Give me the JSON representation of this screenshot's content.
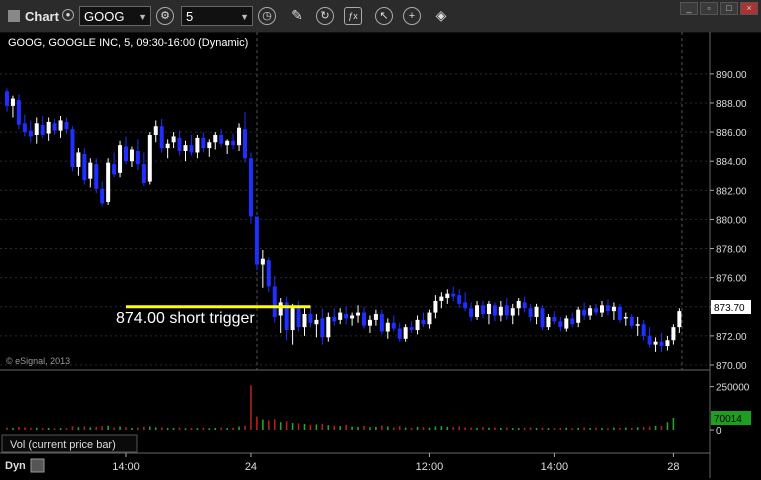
{
  "toolbar": {
    "app_title": "Chart",
    "symbol": "GOOG",
    "interval": "5",
    "icons": [
      "chart-type-icon",
      "interval-clock-icon",
      "pencil-draw-icon",
      "refresh-icon",
      "studies-icon",
      "cursor-icon",
      "add-link-icon"
    ]
  },
  "colors": {
    "up": "#ffffff",
    "down": "#1f2fff",
    "trigger_line": "#ffff00",
    "vol_up": "#2e9e2e",
    "vol_down": "#b02020",
    "last_price_badge": "#ffffff",
    "volume_badge": "#1e9e1e"
  },
  "chart_data": {
    "type": "candlestick",
    "title": "GOOG, GOOGLE INC, 5, 09:30-16:00 (Dynamic)",
    "copyright": "© eSignal, 2013",
    "price_axis": {
      "ticks": [
        "890.00",
        "888.00",
        "886.00",
        "884.00",
        "882.00",
        "880.00",
        "878.00",
        "876.00",
        "874.00",
        "872.00",
        "870.00"
      ],
      "ylim": [
        870,
        891.5
      ]
    },
    "last_price": "873.70",
    "time_axis": {
      "ticks": [
        "14:00",
        "24",
        "12:00",
        "14:00",
        "28"
      ],
      "tick_bars": [
        20,
        41,
        71,
        92,
        112
      ]
    },
    "session_break_bars": [
      41,
      112
    ],
    "annotation": {
      "label": "874.00 short trigger",
      "price": 874.0,
      "from_bar": 20,
      "to_bar": 51
    },
    "volume_panel": {
      "label": "Vol (current price bar)",
      "ticks": [
        "250000",
        "0"
      ],
      "last_volume": "70014",
      "ylim": [
        0,
        300000
      ]
    },
    "bottom_label": "Dyn",
    "candles": [
      [
        888.8,
        889.0,
        887.4,
        887.8
      ],
      [
        887.8,
        888.5,
        887.0,
        888.3
      ],
      [
        888.2,
        888.6,
        886.2,
        886.5
      ],
      [
        886.6,
        887.2,
        885.7,
        886.0
      ],
      [
        886.1,
        886.8,
        885.3,
        885.7
      ],
      [
        885.8,
        887.0,
        885.2,
        886.6
      ],
      [
        886.5,
        887.1,
        885.6,
        885.8
      ],
      [
        885.9,
        887.0,
        885.4,
        886.7
      ],
      [
        886.6,
        886.9,
        885.8,
        886.1
      ],
      [
        886.1,
        887.1,
        885.6,
        886.8
      ],
      [
        886.7,
        887.0,
        885.9,
        886.2
      ],
      [
        886.2,
        886.4,
        883.3,
        883.6
      ],
      [
        883.6,
        884.9,
        883.0,
        884.6
      ],
      [
        884.5,
        884.9,
        882.4,
        882.7
      ],
      [
        882.8,
        884.2,
        882.2,
        883.9
      ],
      [
        883.8,
        884.2,
        881.8,
        882.1
      ],
      [
        882.1,
        882.6,
        880.9,
        881.1
      ],
      [
        881.2,
        884.2,
        881.0,
        883.9
      ],
      [
        883.8,
        884.6,
        882.9,
        883.1
      ],
      [
        883.2,
        885.4,
        882.9,
        885.1
      ],
      [
        885.0,
        885.7,
        883.8,
        884.0
      ],
      [
        884.0,
        885.0,
        883.6,
        884.8
      ],
      [
        884.7,
        885.5,
        883.4,
        883.8
      ],
      [
        883.8,
        884.6,
        882.3,
        882.5
      ],
      [
        882.6,
        886.0,
        882.4,
        885.8
      ],
      [
        885.8,
        886.8,
        885.3,
        886.4
      ],
      [
        886.4,
        886.9,
        884.6,
        884.9
      ],
      [
        884.9,
        885.5,
        884.2,
        885.2
      ],
      [
        885.3,
        886.0,
        884.9,
        885.7
      ],
      [
        885.6,
        886.1,
        884.4,
        884.7
      ],
      [
        884.7,
        885.4,
        884.0,
        885.1
      ],
      [
        885.1,
        885.8,
        884.4,
        884.6
      ],
      [
        884.6,
        885.8,
        884.2,
        885.6
      ],
      [
        885.6,
        886.0,
        884.6,
        884.9
      ],
      [
        884.9,
        885.5,
        884.3,
        885.3
      ],
      [
        885.3,
        886.0,
        884.8,
        885.8
      ],
      [
        885.8,
        886.2,
        885.0,
        885.2
      ],
      [
        885.1,
        885.5,
        884.5,
        885.4
      ],
      [
        885.4,
        885.9,
        884.8,
        885.1
      ],
      [
        885.1,
        886.6,
        884.7,
        886.3
      ],
      [
        886.2,
        887.4,
        883.9,
        884.2
      ],
      [
        884.2,
        884.6,
        879.7,
        880.2
      ],
      [
        880.2,
        878.6,
        876.5,
        876.9
      ],
      [
        876.9,
        877.9,
        875.3,
        877.3
      ],
      [
        877.2,
        877.4,
        875.0,
        875.4
      ],
      [
        875.4,
        876.1,
        872.9,
        873.3
      ],
      [
        873.4,
        874.6,
        872.2,
        874.3
      ],
      [
        874.3,
        874.7,
        871.7,
        872.4
      ],
      [
        872.4,
        874.2,
        871.4,
        873.9
      ],
      [
        873.9,
        874.4,
        872.3,
        872.6
      ],
      [
        872.6,
        873.9,
        872.0,
        873.5
      ],
      [
        873.5,
        874.0,
        872.6,
        872.9
      ],
      [
        872.8,
        873.5,
        871.9,
        873.1
      ],
      [
        873.2,
        873.9,
        871.4,
        871.9
      ],
      [
        871.9,
        873.6,
        871.6,
        873.3
      ],
      [
        873.3,
        873.9,
        872.7,
        873.0
      ],
      [
        873.1,
        873.9,
        872.8,
        873.6
      ],
      [
        873.5,
        874.0,
        872.8,
        873.2
      ],
      [
        873.2,
        873.6,
        872.7,
        873.4
      ],
      [
        873.4,
        874.1,
        872.9,
        873.6
      ],
      [
        873.6,
        874.0,
        872.5,
        872.7
      ],
      [
        872.7,
        873.4,
        872.2,
        873.1
      ],
      [
        873.1,
        873.8,
        872.7,
        873.5
      ],
      [
        873.5,
        873.8,
        872.1,
        872.3
      ],
      [
        872.3,
        873.2,
        871.8,
        872.9
      ],
      [
        872.9,
        873.4,
        872.3,
        872.5
      ],
      [
        872.5,
        872.9,
        871.6,
        871.8
      ],
      [
        871.8,
        872.8,
        871.6,
        872.6
      ],
      [
        872.6,
        873.0,
        872.2,
        872.4
      ],
      [
        872.4,
        873.4,
        872.1,
        873.1
      ],
      [
        873.1,
        873.6,
        872.6,
        872.8
      ],
      [
        872.8,
        873.8,
        872.5,
        873.6
      ],
      [
        873.6,
        874.8,
        873.2,
        874.4
      ],
      [
        874.4,
        875.0,
        873.9,
        874.7
      ],
      [
        874.6,
        875.2,
        874.2,
        874.9
      ],
      [
        874.9,
        875.4,
        874.4,
        874.7
      ],
      [
        874.8,
        875.2,
        873.9,
        874.2
      ],
      [
        874.3,
        875.0,
        873.7,
        873.9
      ],
      [
        873.9,
        874.3,
        873.0,
        873.3
      ],
      [
        873.3,
        874.4,
        873.1,
        874.1
      ],
      [
        874.1,
        874.4,
        873.2,
        873.5
      ],
      [
        873.5,
        874.4,
        872.8,
        874.2
      ],
      [
        874.1,
        874.3,
        873.0,
        873.4
      ],
      [
        873.4,
        874.4,
        873.0,
        874.0
      ],
      [
        874.1,
        874.6,
        873.1,
        873.4
      ],
      [
        873.4,
        874.2,
        872.8,
        873.9
      ],
      [
        873.9,
        874.6,
        873.4,
        874.4
      ],
      [
        874.3,
        874.7,
        873.6,
        873.9
      ],
      [
        873.9,
        874.2,
        873.0,
        873.3
      ],
      [
        873.3,
        874.2,
        872.8,
        874.0
      ],
      [
        873.9,
        874.1,
        872.4,
        872.6
      ],
      [
        872.6,
        873.5,
        872.4,
        873.3
      ],
      [
        873.3,
        873.7,
        872.8,
        873.0
      ],
      [
        873.0,
        873.3,
        872.3,
        872.6
      ],
      [
        872.5,
        873.4,
        872.3,
        873.2
      ],
      [
        873.2,
        873.6,
        872.6,
        872.8
      ],
      [
        872.9,
        874.0,
        872.6,
        873.8
      ],
      [
        873.8,
        874.3,
        873.1,
        873.4
      ],
      [
        873.4,
        874.1,
        873.1,
        873.9
      ],
      [
        873.9,
        874.2,
        873.4,
        873.6
      ],
      [
        873.6,
        874.4,
        873.3,
        874.1
      ],
      [
        874.1,
        874.5,
        873.4,
        873.7
      ],
      [
        873.7,
        874.3,
        873.1,
        874.0
      ],
      [
        874.0,
        874.2,
        872.9,
        873.1
      ],
      [
        873.2,
        873.6,
        872.7,
        873.3
      ],
      [
        873.3,
        873.5,
        872.5,
        872.7
      ],
      [
        872.7,
        873.3,
        872.0,
        872.8
      ],
      [
        872.8,
        873.1,
        871.7,
        872.0
      ],
      [
        872.0,
        872.6,
        871.2,
        871.4
      ],
      [
        871.4,
        871.9,
        870.9,
        871.6
      ],
      [
        871.6,
        872.2,
        870.9,
        871.3
      ],
      [
        871.3,
        872.0,
        871.0,
        871.7
      ],
      [
        871.7,
        872.8,
        871.4,
        872.6
      ],
      [
        872.6,
        873.9,
        872.2,
        873.7
      ]
    ],
    "volumes": [
      14000,
      12000,
      18000,
      15000,
      11000,
      13000,
      10000,
      12000,
      9000,
      11000,
      10000,
      22000,
      16000,
      20000,
      15000,
      18000,
      22000,
      25000,
      14000,
      20000,
      16000,
      12000,
      14000,
      18000,
      20000,
      15000,
      16000,
      11000,
      12000,
      14000,
      10000,
      12000,
      11000,
      13000,
      10000,
      12000,
      14000,
      11000,
      13000,
      20000,
      25000,
      258000,
      78000,
      60000,
      55000,
      62000,
      45000,
      50000,
      40000,
      38000,
      35000,
      30000,
      32000,
      36000,
      28000,
      24000,
      22000,
      30000,
      20000,
      18000,
      24000,
      16000,
      18000,
      26000,
      20000,
      15000,
      22000,
      14000,
      12000,
      18000,
      16000,
      14000,
      20000,
      22000,
      18000,
      16000,
      20000,
      15000,
      14000,
      12000,
      16000,
      13000,
      15000,
      12000,
      14000,
      11000,
      12000,
      13000,
      15000,
      12000,
      14000,
      11000,
      10000,
      12000,
      13000,
      10000,
      12000,
      15000,
      11000,
      13000,
      12000,
      10000,
      14000,
      12000,
      15000,
      13000,
      16000,
      18000,
      20000,
      24000,
      22000,
      45000,
      70014
    ]
  }
}
